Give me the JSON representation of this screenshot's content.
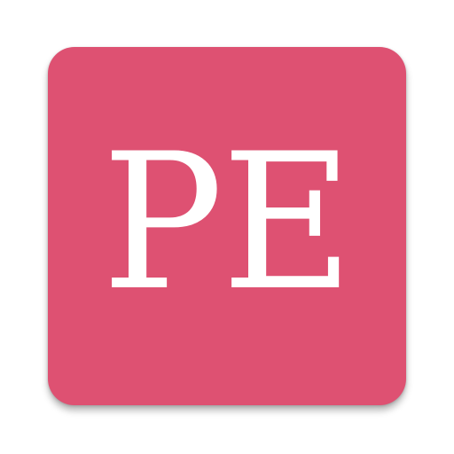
{
  "icon": {
    "monogram": "PE",
    "background_color": "#de5172",
    "text_color": "#ffffff"
  }
}
